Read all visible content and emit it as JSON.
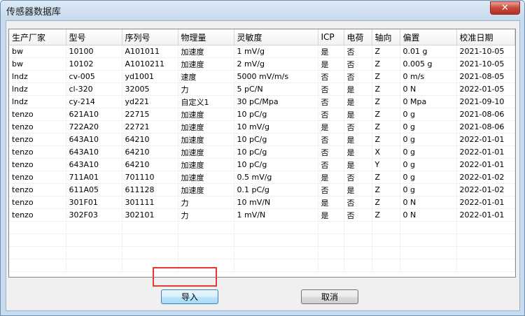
{
  "window": {
    "title": "传感器数据库",
    "close_glyph": "✕"
  },
  "table": {
    "columns": [
      {
        "key": "maker",
        "label": "生产厂家"
      },
      {
        "key": "model",
        "label": "型号"
      },
      {
        "key": "serial",
        "label": "序列号"
      },
      {
        "key": "quantity",
        "label": "物理量"
      },
      {
        "key": "sensitivity",
        "label": "灵敏度"
      },
      {
        "key": "icp",
        "label": "ICP"
      },
      {
        "key": "charge",
        "label": "电荷"
      },
      {
        "key": "axis",
        "label": "轴向"
      },
      {
        "key": "offset",
        "label": "偏置"
      },
      {
        "key": "cal_date",
        "label": "校准日期"
      }
    ],
    "rows": [
      [
        "bw",
        "10100",
        "A101011",
        "加速度",
        "1 mV/g",
        "是",
        "否",
        "Z",
        "0.01 g",
        "2021-10-05"
      ],
      [
        "bw",
        "10102",
        "A1010211",
        "加速度",
        "2 mV/g",
        "是",
        "否",
        "Z",
        "0.005 g",
        "2021-10-05"
      ],
      [
        "lndz",
        "cv-005",
        "yd1001",
        "速度",
        "5000 mV/m/s",
        "否",
        "否",
        "Z",
        "0 m/s",
        "2021-08-05"
      ],
      [
        "lndz",
        "cl-320",
        "32005",
        "力",
        "5 pC/N",
        "否",
        "是",
        "Z",
        "0 N",
        "2022-01-05"
      ],
      [
        "lndz",
        "cy-214",
        "yd221",
        "自定义1",
        "30 pC/Mpa",
        "否",
        "是",
        "Z",
        "0 Mpa",
        "2021-09-10"
      ],
      [
        "tenzo",
        "621A10",
        "22715",
        "加速度",
        "10 pC/g",
        "否",
        "是",
        "Z",
        "0 g",
        "2021-08-06"
      ],
      [
        "tenzo",
        "722A20",
        "22721",
        "加速度",
        "10 mV/g",
        "是",
        "否",
        "Z",
        "0 g",
        "2021-08-06"
      ],
      [
        "tenzo",
        "643A10",
        "64210",
        "加速度",
        "10 pC/g",
        "否",
        "是",
        "Z",
        "0 g",
        "2022-01-01"
      ],
      [
        "tenzo",
        "643A10",
        "64210",
        "加速度",
        "10 pC/g",
        "否",
        "是",
        "X",
        "0 g",
        "2022-01-01"
      ],
      [
        "tenzo",
        "643A10",
        "64210",
        "加速度",
        "10 pC/g",
        "否",
        "是",
        "Y",
        "0 g",
        "2022-01-01"
      ],
      [
        "tenzo",
        "711A01",
        "701110",
        "加速度",
        "0.5 mV/g",
        "是",
        "否",
        "Z",
        "0 g",
        "2022-01-02"
      ],
      [
        "tenzo",
        "611A05",
        "611128",
        "加速度",
        "0.1 pC/g",
        "否",
        "是",
        "Z",
        "0 g",
        "2022-01-02"
      ],
      [
        "tenzo",
        "301F01",
        "301111",
        "力",
        "10 mV/N",
        "是",
        "否",
        "Z",
        "0 N",
        "2022-01-01"
      ],
      [
        "tenzo",
        "302F03",
        "302101",
        "力",
        "1 mV/N",
        "是",
        "否",
        "Z",
        "0 N",
        "2022-01-01"
      ]
    ]
  },
  "buttons": {
    "import_label": "导入",
    "cancel_label": "取消"
  }
}
